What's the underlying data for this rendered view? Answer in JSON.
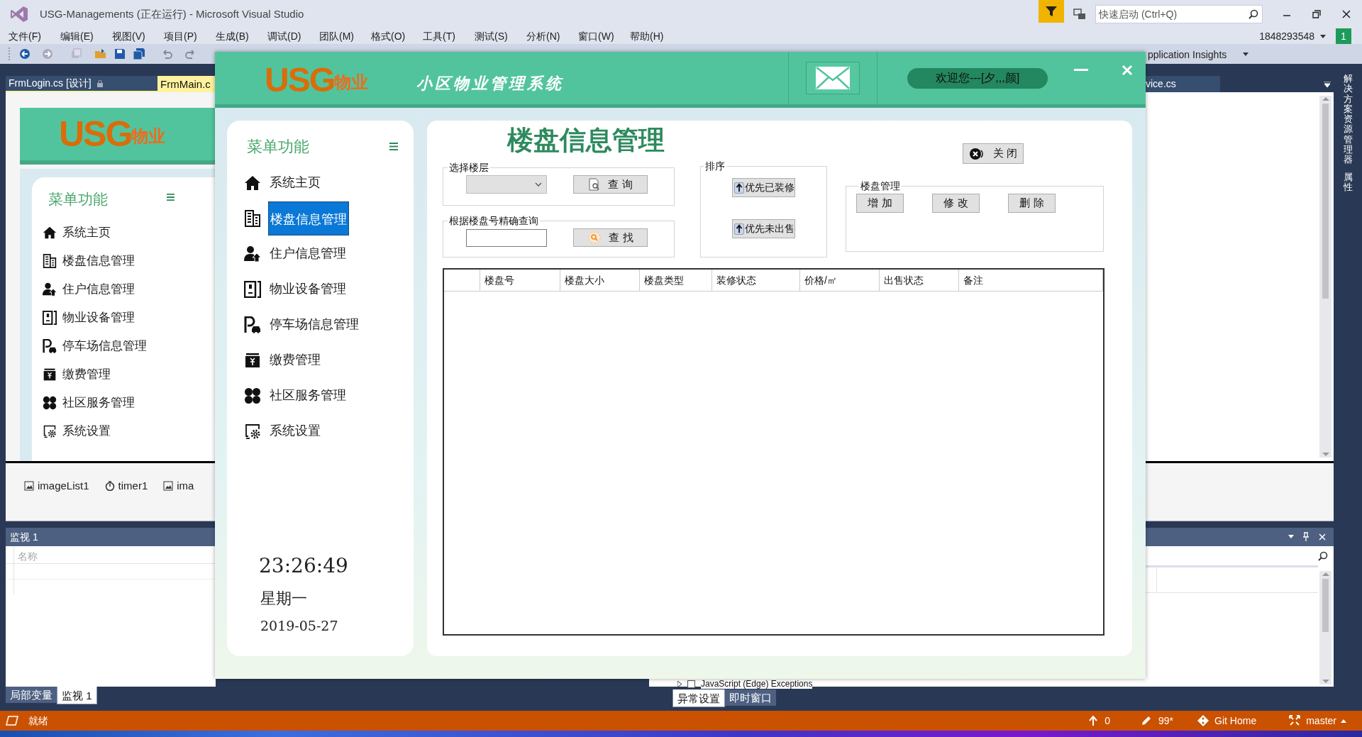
{
  "vs": {
    "title": "USG-Managements (正在运行) - Microsoft Visual Studio",
    "quick_launch": {
      "placeholder": "快速启动 (Ctrl+Q)"
    },
    "menu": [
      "文件(F)",
      "编辑(E)",
      "视图(V)",
      "项目(P)",
      "生成(B)",
      "调试(D)",
      "团队(M)",
      "格式(O)",
      "工具(T)",
      "测试(S)",
      "分析(N)",
      "窗口(W)",
      "帮助(H)"
    ],
    "account": "1848293548",
    "notification_count": "1",
    "insights": "pplication Insights",
    "doc_tabs": [
      {
        "label": "FrmLogin.cs [设计]",
        "selected": false
      },
      {
        "label": "FrmMain.c",
        "selected": true
      }
    ],
    "right_tab": "vice.cs",
    "side_panels": [
      "解决方案资源管理器",
      "属性"
    ],
    "tray": [
      "imageList1",
      "timer1",
      "ima"
    ],
    "watch": {
      "title": "监视 1",
      "column": "名称"
    },
    "bottom_tabs": [
      {
        "label": "局部变量",
        "selected": false
      },
      {
        "label": "监视 1",
        "selected": true
      }
    ],
    "exception_row": "JavaScript (Edge) Exceptions",
    "exception_checked": false,
    "exception_tabs": [
      {
        "label": "异常设置",
        "selected": true
      },
      {
        "label": "即时窗口",
        "selected": false
      }
    ],
    "status": {
      "text": "就绪",
      "pushes": "0",
      "changes": "99*",
      "repo": "Git Home",
      "branch": "master"
    }
  },
  "designer": {
    "logo": {
      "mark": "USG",
      "suffix": "物业"
    },
    "menu_title": "菜单功能",
    "menu_items": [
      "系统主页",
      "楼盘信息管理",
      "住户信息管理",
      "物业设备管理",
      "停车场信息管理",
      "缴费管理",
      "社区服务管理",
      "系统设置"
    ]
  },
  "app": {
    "logo": {
      "mark": "USG",
      "suffix": "物业"
    },
    "title": "小区物业管理系统",
    "welcome": "欢迎您---[夕,,,颜]",
    "menu_title": "菜单功能",
    "menu": [
      {
        "label": "系统主页",
        "selected": false
      },
      {
        "label": "楼盘信息管理",
        "selected": true
      },
      {
        "label": "住户信息管理",
        "selected": false
      },
      {
        "label": "物业设备管理",
        "selected": false
      },
      {
        "label": "停车场信息管理",
        "selected": false
      },
      {
        "label": "缴费管理",
        "selected": false
      },
      {
        "label": "社区服务管理",
        "selected": false
      },
      {
        "label": "系统设置",
        "selected": false
      }
    ],
    "clock": {
      "time": "23:26:49",
      "weekday": "星期一",
      "date": "2019-05-27"
    },
    "page_title": "楼盘信息管理",
    "floor_group": {
      "legend": "选择楼层",
      "button": "查 询"
    },
    "search_group": {
      "legend": "根据楼盘号精确查询",
      "button": "查 找"
    },
    "sort_group": {
      "legend": "排序",
      "buttons": [
        "优先已装修",
        "优先未出售"
      ]
    },
    "close_button": "关 闭",
    "manage_group": {
      "legend": "楼盘管理",
      "buttons": [
        "增 加",
        "修 改",
        "删 除"
      ]
    },
    "table": {
      "columns": [
        "楼盘号",
        "楼盘大小",
        "楼盘类型",
        "装修状态",
        "价格/㎡",
        "出售状态",
        "备注"
      ]
    }
  }
}
